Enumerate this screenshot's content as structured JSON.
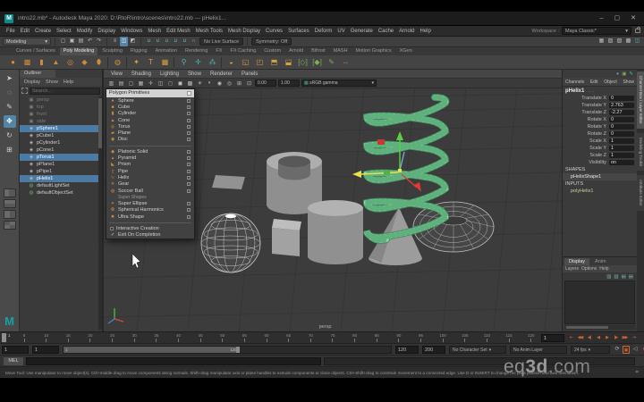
{
  "window": {
    "logo": "M",
    "title": "intro22.mb* - Autodesk Maya 2020: D:\\RtoR\\intro\\scenes\\intro22.mb  ---  pHelix1...",
    "min": "–",
    "max": "▢",
    "close": "✕",
    "workspace_label": "Workspace :",
    "workspace": "Maya Classic*"
  },
  "menubar": {
    "items": [
      "File",
      "Edit",
      "Create",
      "Select",
      "Modify",
      "Display",
      "Windows",
      "Mesh",
      "Edit Mesh",
      "Mesh Tools",
      "Mesh Display",
      "Curves",
      "Surfaces",
      "Deform",
      "UV",
      "Generate",
      "Cache",
      "Arnold",
      "Help"
    ]
  },
  "statusline": {
    "mode": "Modeling",
    "mode_arrow": "▾",
    "file_icons": [
      {
        "name": "new-scene-icon",
        "g": "▢"
      },
      {
        "name": "open-scene-icon",
        "g": "▣"
      },
      {
        "name": "save-scene-icon",
        "g": "▤"
      },
      {
        "name": "undo-icon",
        "g": "↶"
      },
      {
        "name": "redo-icon",
        "g": "↷"
      }
    ],
    "select_icons": [
      {
        "name": "select-hierarchy-icon",
        "g": "≡"
      },
      {
        "name": "select-object-icon",
        "g": "◫",
        "cls": "act"
      },
      {
        "name": "select-component-icon",
        "g": "◩"
      }
    ],
    "snap_icons": [
      {
        "name": "snap-grid-icon",
        "g": "∪",
        "cls": "snp"
      },
      {
        "name": "snap-curve-icon",
        "g": "∪",
        "cls": "snp"
      },
      {
        "name": "snap-point-icon",
        "g": "∪",
        "cls": "snp"
      },
      {
        "name": "snap-projected-icon",
        "g": "∪",
        "cls": "snp"
      },
      {
        "name": "snap-view-icon",
        "g": "∪",
        "cls": "snp"
      },
      {
        "name": "make-live-icon",
        "g": "∩",
        "cls": "snp"
      }
    ],
    "live": "No Live Surface",
    "symmetry": "Symmetry: Off",
    "right_icons": [
      {
        "name": "render-view-icon",
        "g": "▦"
      },
      {
        "name": "render-current-icon",
        "g": "▧"
      },
      {
        "name": "ipr-render-icon",
        "g": "▨"
      },
      {
        "name": "render-settings-icon",
        "g": "▩"
      },
      {
        "name": "display-layers-icon",
        "g": "◫",
        "cls": "teal"
      }
    ]
  },
  "shelf": {
    "tabs": [
      {
        "label": "Curves / Surfaces"
      },
      {
        "label": "Poly Modeling",
        "cls": "active"
      },
      {
        "label": "Sculpting"
      },
      {
        "label": "Rigging"
      },
      {
        "label": "Animation"
      },
      {
        "label": "Rendering"
      },
      {
        "label": "FX"
      },
      {
        "label": "FX Caching"
      },
      {
        "label": "Custom"
      },
      {
        "label": "Arnold"
      },
      {
        "label": "Bifrost"
      },
      {
        "label": "MASH"
      },
      {
        "label": "Motion Graphics"
      },
      {
        "label": "XGen"
      }
    ],
    "icons": [
      {
        "name": "shelf-sphere-icon",
        "g": "●"
      },
      {
        "name": "shelf-cube-icon",
        "g": "▩"
      },
      {
        "name": "shelf-cylinder-icon",
        "g": "▮"
      },
      {
        "name": "shelf-cone-icon",
        "g": "▲"
      },
      {
        "name": "shelf-torus-icon",
        "g": "◎"
      },
      {
        "name": "shelf-plane-icon",
        "g": "◆"
      },
      {
        "name": "shelf-disc-icon",
        "g": "⬮"
      },
      {
        "name": "shelf-separator",
        "g": "",
        "cls": "ssep"
      },
      {
        "name": "shelf-sphere-proj-icon",
        "g": "◍"
      },
      {
        "name": "shelf-separator",
        "g": "",
        "cls": "ssep"
      },
      {
        "name": "shelf-star-icon",
        "g": "✦",
        "cls": "gold"
      },
      {
        "name": "shelf-type-icon",
        "g": "T",
        "cls": "gold"
      },
      {
        "name": "shelf-image-plane-icon",
        "g": "▦",
        "cls": "gold"
      },
      {
        "name": "shelf-separator",
        "g": "",
        "cls": "ssep"
      },
      {
        "name": "shelf-joint-icon",
        "g": "⚲",
        "cls": "tea"
      },
      {
        "name": "shelf-ik-icon",
        "g": "✛",
        "cls": "tea"
      },
      {
        "name": "shelf-skeleton-icon",
        "g": "⁂",
        "cls": "tea"
      },
      {
        "name": "shelf-separator",
        "g": "",
        "cls": "ssep"
      },
      {
        "name": "shelf-smooth-icon",
        "g": "◒",
        "cls": "gold"
      },
      {
        "name": "shelf-combine-icon",
        "g": "◱",
        "cls": "gold"
      },
      {
        "name": "shelf-boolean-icon",
        "g": "◰",
        "cls": "gold"
      },
      {
        "name": "shelf-extrude-icon",
        "g": "⬒",
        "cls": "gold"
      },
      {
        "name": "shelf-bridge-icon",
        "g": "⬓",
        "cls": "gold"
      },
      {
        "name": "shelf-multicut-icon",
        "g": "[◇]",
        "cls": "grn"
      },
      {
        "name": "shelf-target-weld-icon",
        "g": "[◆]",
        "cls": "grn"
      },
      {
        "name": "shelf-quaddraw-icon",
        "g": "✎",
        "cls": "grn"
      },
      {
        "name": "shelf-mirror-icon",
        "g": "⇔",
        "cls": "grn"
      }
    ]
  },
  "toolbox": {
    "tools": [
      {
        "name": "select-tool",
        "g": "➤"
      },
      {
        "name": "lasso-tool",
        "g": "◌"
      },
      {
        "name": "paint-select-tool",
        "g": "✎"
      },
      {
        "name": "move-tool",
        "g": "✥",
        "cls": "act"
      },
      {
        "name": "rotate-tool",
        "g": "↻"
      },
      {
        "name": "scale-tool",
        "g": "⊞"
      }
    ]
  },
  "outliner": {
    "tab": "Outliner",
    "menus": [
      "Display",
      "Show",
      "Help"
    ],
    "search": "Search...",
    "items": [
      {
        "label": "persp",
        "g": "▣",
        "cls": "dim"
      },
      {
        "label": "top",
        "g": "▣",
        "cls": "dim"
      },
      {
        "label": "front",
        "g": "▣",
        "cls": "dim"
      },
      {
        "label": "side",
        "g": "▣",
        "cls": "dim"
      },
      {
        "label": "pSphere1",
        "g": "◈",
        "cls": "sel"
      },
      {
        "label": "pCube1",
        "g": "◈"
      },
      {
        "label": "pCylinder1",
        "g": "◈"
      },
      {
        "label": "pCone1",
        "g": "◈"
      },
      {
        "label": "pTorus1",
        "g": "◈",
        "cls": "sel"
      },
      {
        "label": "pPlane1",
        "g": "◈"
      },
      {
        "label": "pPipe1",
        "g": "◈"
      },
      {
        "label": "pHelix1",
        "g": "◈",
        "cls": "sel"
      },
      {
        "label": "defaultLightSet",
        "g": "◍",
        "cls": "set"
      },
      {
        "label": "defaultObjectSet",
        "g": "◍",
        "cls": "set"
      }
    ]
  },
  "popup": {
    "title": "Polygon Primitives",
    "items": [
      {
        "label": "Sphere",
        "g": "●"
      },
      {
        "label": "Cube",
        "g": "■"
      },
      {
        "label": "Cylinder",
        "g": "▮"
      },
      {
        "label": "Cone",
        "g": "▲"
      },
      {
        "label": "Torus",
        "g": "◎"
      },
      {
        "label": "Plane",
        "g": "▰"
      },
      {
        "label": "Disc",
        "g": "◉"
      },
      {
        "cls": "psep"
      },
      {
        "label": "Platonic Solid",
        "g": "◆"
      },
      {
        "label": "Pyramid",
        "g": "▴"
      },
      {
        "label": "Prism",
        "g": "◣"
      },
      {
        "label": "Pipe",
        "g": "▯"
      },
      {
        "label": "Helix",
        "g": "∿"
      },
      {
        "label": "Gear",
        "g": "✳"
      },
      {
        "label": "Soccer Ball",
        "g": "◍"
      },
      {
        "label": "Super Shapes",
        "cls": "phead"
      },
      {
        "label": "Super Ellipse",
        "g": "✶"
      },
      {
        "label": "Spherical Harmonics",
        "g": "❂"
      },
      {
        "label": "Ultra Shape",
        "g": "✸"
      },
      {
        "cls": "psep"
      },
      {
        "label": "Interactive Creation",
        "g": "",
        "cls": "ptoggle pbox"
      },
      {
        "label": "Exit On Completion",
        "g": "✓",
        "cls": "ptoggle"
      }
    ]
  },
  "viewport": {
    "menus": [
      "View",
      "Shading",
      "Lighting",
      "Show",
      "Renderer",
      "Panels"
    ],
    "icons": [
      {
        "name": "camera-lock-icon",
        "g": "▥"
      },
      {
        "name": "camera-attrs-icon",
        "g": "▤"
      },
      {
        "name": "bookmark-icon",
        "g": "▢"
      },
      {
        "name": "image-plane-icon",
        "g": "▦"
      },
      {
        "name": "2d-pan-icon",
        "g": "✛"
      },
      {
        "name": "oneclick-icon",
        "g": "◫"
      },
      {
        "name": "wireframe-icon",
        "g": "◻"
      },
      {
        "name": "shaded-icon",
        "g": "◼"
      },
      {
        "name": "textured-icon",
        "g": "▩"
      },
      {
        "name": "lighting-icon",
        "g": "☀"
      },
      {
        "name": "shadows-icon",
        "g": "◐"
      },
      {
        "name": "ao-icon",
        "g": "◉"
      },
      {
        "name": "motionblur-icon",
        "g": "◎"
      },
      {
        "name": "xray-icon",
        "g": "⊞"
      },
      {
        "name": "isolate-icon",
        "g": "⊡"
      }
    ],
    "exposure": "0.00",
    "gamma": "1.00",
    "colorspace": "sRGB gamma",
    "camera": "persp"
  },
  "channelbox": {
    "corner_icons": [
      {
        "name": "character-set-icon",
        "g": "●",
        "cls": "blu"
      },
      {
        "name": "poly-count-icon",
        "g": "▣",
        "cls": "grn"
      },
      {
        "name": "edit-curve-icon",
        "g": "✎",
        "cls": "tea"
      }
    ],
    "menus": [
      "Channels",
      "Edit",
      "Object",
      "Show"
    ],
    "object": "pHelix1",
    "dots": ". . .",
    "rows": [
      {
        "label": "Translate X",
        "value": "0"
      },
      {
        "label": "Translate Y",
        "value": "2.763"
      },
      {
        "label": "Translate Z",
        "value": "-2.27"
      },
      {
        "label": "Rotate X",
        "value": "0"
      },
      {
        "label": "Rotate Y",
        "value": "0"
      },
      {
        "label": "Rotate Z",
        "value": "0"
      },
      {
        "label": "Scale X",
        "value": "1"
      },
      {
        "label": "Scale Y",
        "value": "1"
      },
      {
        "label": "Scale Z",
        "value": "1"
      },
      {
        "label": "Visibility",
        "value": "on"
      }
    ],
    "shapes_label": "SHAPES",
    "shape": "pHelixShape1",
    "inputs_label": "INPUTS",
    "input": "polyHelix1"
  },
  "layers": {
    "tabs": [
      {
        "label": "Display",
        "cls": "active"
      },
      {
        "label": "Anim"
      }
    ],
    "menus": [
      "Layers",
      "Options",
      "Help"
    ],
    "icons": [
      {
        "name": "new-layer-icon",
        "g": "▥"
      },
      {
        "name": "new-layer-selected-icon",
        "g": "▥"
      },
      {
        "name": "move-layer-up-icon",
        "g": "▤"
      },
      {
        "name": "move-layer-down-icon",
        "g": "▤"
      }
    ]
  },
  "side_tabs": [
    {
      "label": "Channel Box / Layer Editor",
      "cls": "active"
    },
    {
      "label": "Modeling Toolkit"
    },
    {
      "label": "Attribute Editor"
    }
  ],
  "timeline": {
    "current": "1",
    "ticks": [
      "5",
      "10",
      "15",
      "20",
      "25",
      "30",
      "35",
      "40",
      "45",
      "50",
      "55",
      "60",
      "65",
      "70",
      "75",
      "80",
      "85",
      "90",
      "95",
      "100",
      "105",
      "110",
      "115",
      "120"
    ],
    "time_field": "1",
    "playback": [
      {
        "name": "go-to-start-button",
        "g": "⇤"
      },
      {
        "name": "step-back-frame-button",
        "g": "◀◀"
      },
      {
        "name": "step-back-key-button",
        "g": "◀|"
      },
      {
        "name": "play-backwards-button",
        "g": "◀"
      },
      {
        "name": "play-forwards-button",
        "g": "▶"
      },
      {
        "name": "step-forward-key-button",
        "g": "|▶"
      },
      {
        "name": "step-forward-frame-button",
        "g": "▶▶"
      },
      {
        "name": "go-to-end-button",
        "g": "⇥"
      }
    ]
  },
  "range": {
    "anim_start": "1",
    "play_start": "1",
    "bar_start": "1",
    "bar_end": "120",
    "play_end": "120",
    "anim_end": "200",
    "charset": "No Character Set",
    "charset_arrow": "▾",
    "anim_layer": "No Anim Layer",
    "fps": "24 fps",
    "fps_arrow": "▾",
    "icons": [
      {
        "name": "playback-loop-icon",
        "g": "⟳"
      },
      {
        "name": "clipboard-icon",
        "g": "▣",
        "cls": "org"
      },
      {
        "name": "mute-icon",
        "g": "◁"
      },
      {
        "name": "auto-key-icon",
        "g": "●",
        "cls": "red"
      }
    ]
  },
  "command": {
    "label": "MEL"
  },
  "help": {
    "text": "Move Tool: Use manipulator to move object(s). Ctrl+middle drag to move components along normals. Shift+drag manipulator axis or plane handles to extrude components or clone objects. Ctrl+Shift+drag to constrain movement to a connected edge. Use D or INSERT to change the pivot position and axis orientation.",
    "icon": "⌗"
  },
  "watermark": {
    "pre": "eq",
    "bold": "3d",
    "post": ".com"
  }
}
